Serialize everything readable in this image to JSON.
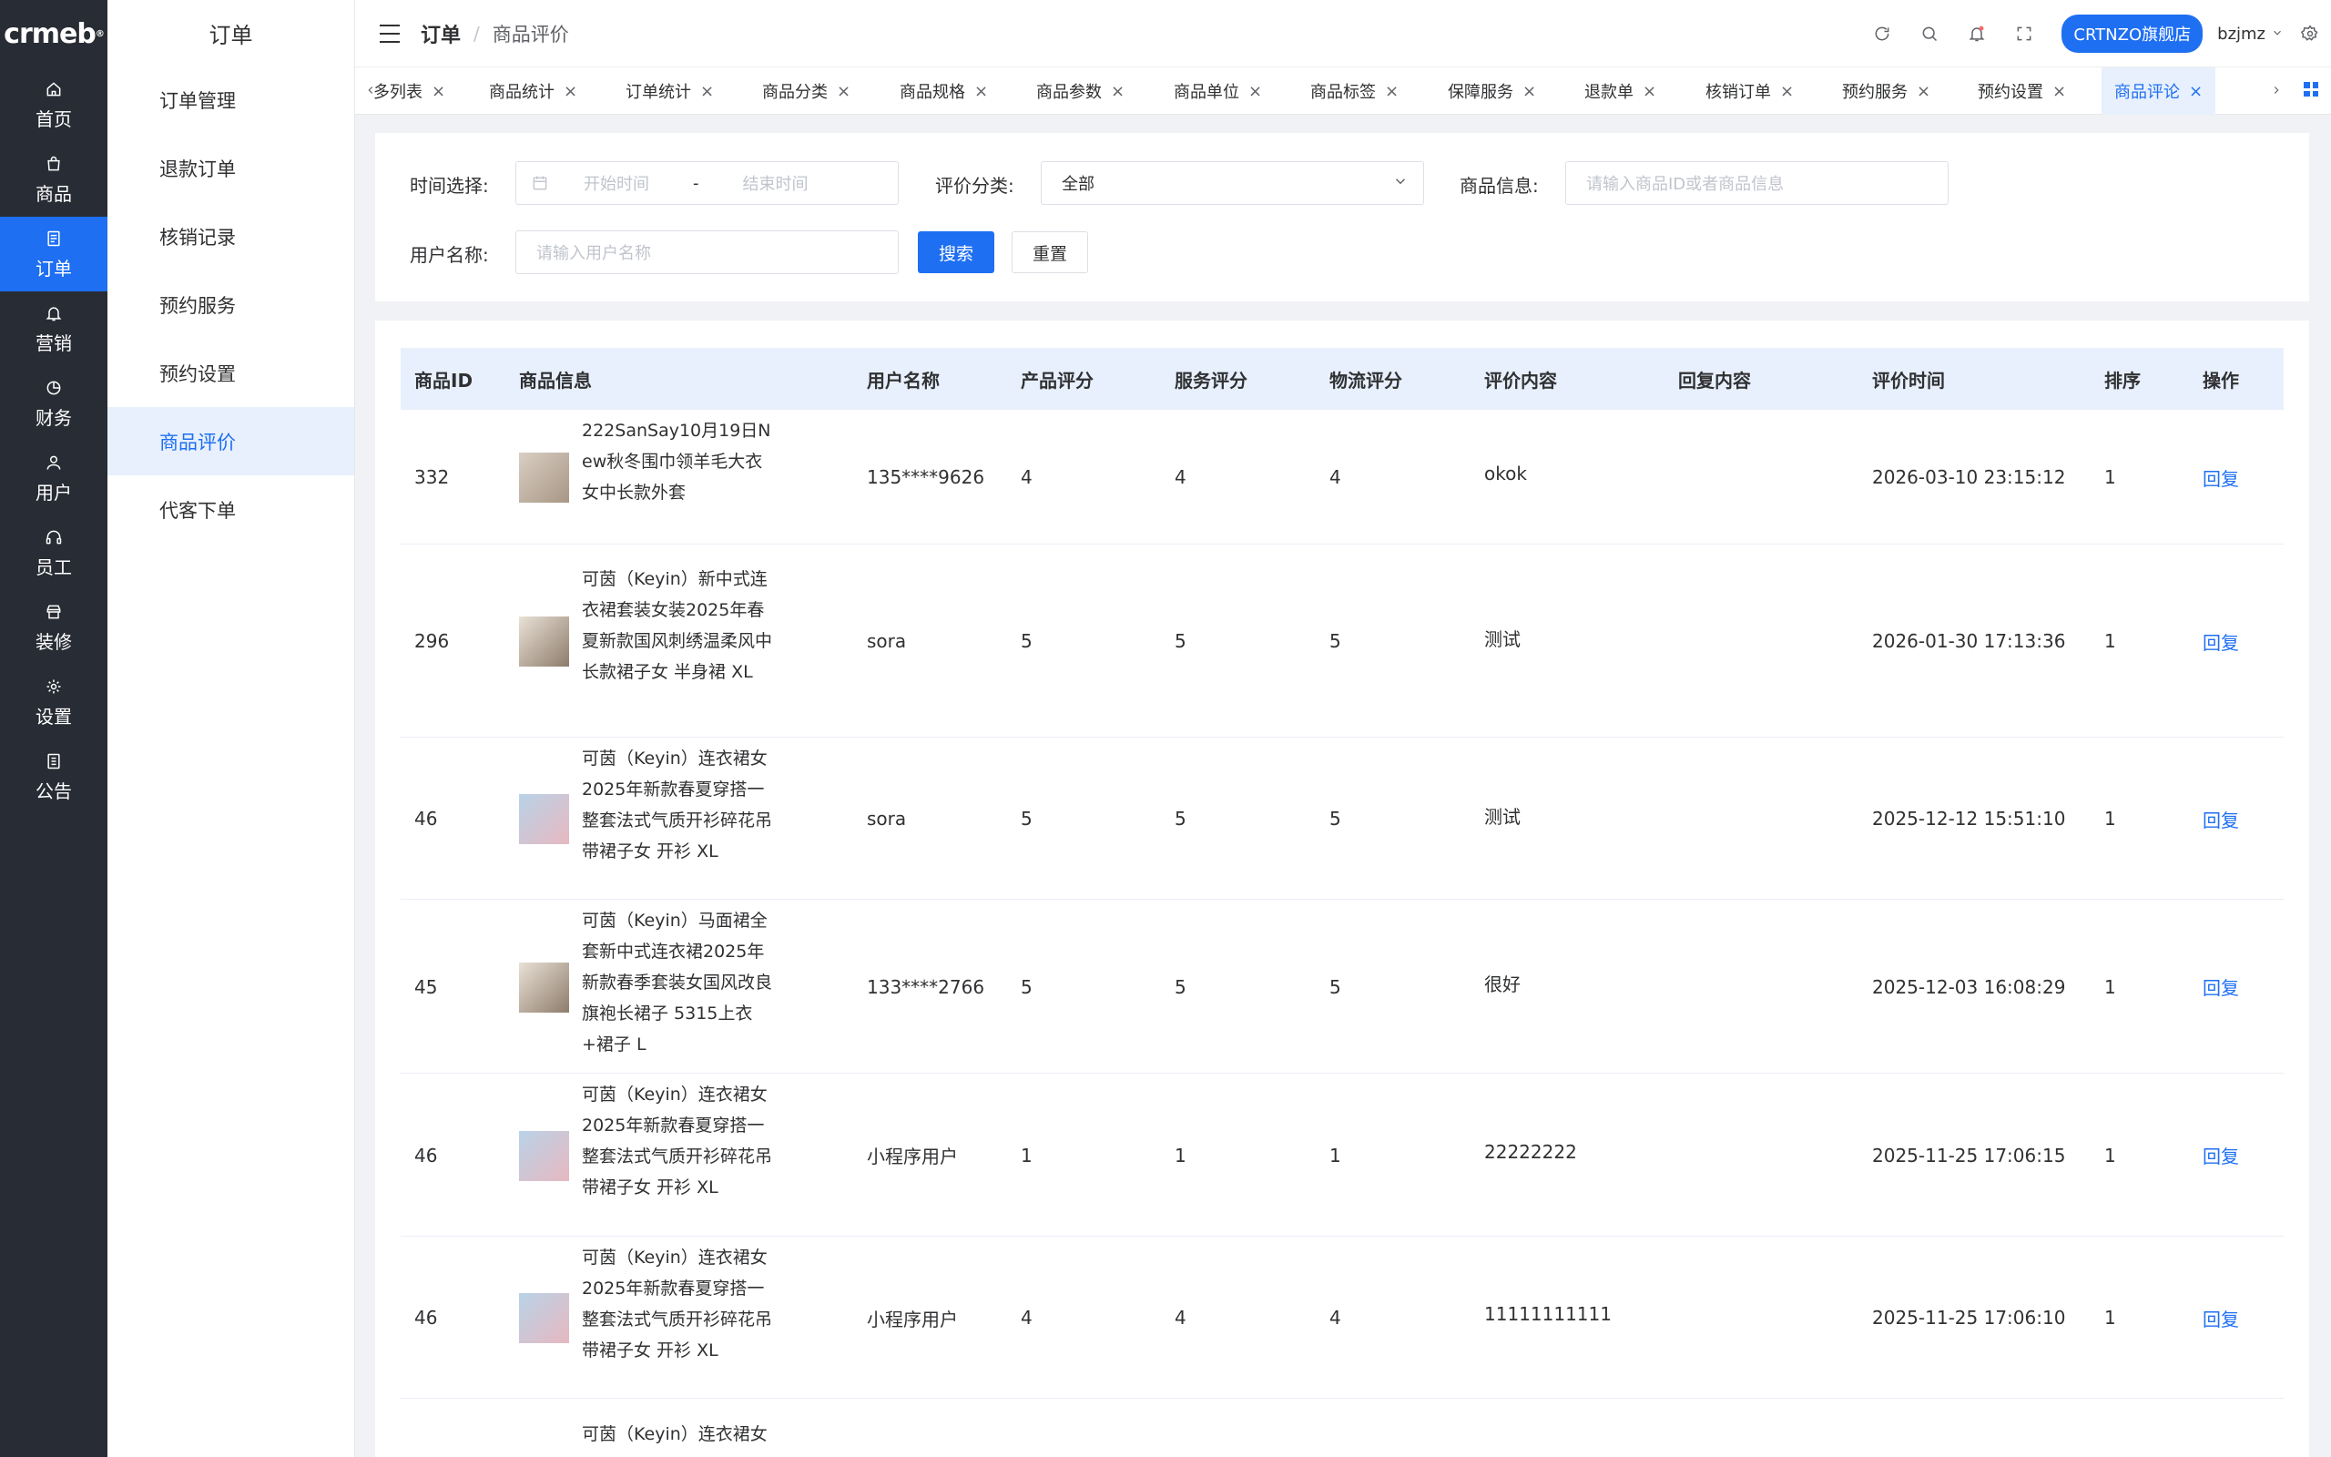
{
  "brand": {
    "logo": "crmeb"
  },
  "rail": [
    {
      "label": "首页",
      "icon": "home-icon"
    },
    {
      "label": "商品",
      "icon": "bag-icon"
    },
    {
      "label": "订单",
      "icon": "order-icon"
    },
    {
      "label": "营销",
      "icon": "bell-icon"
    },
    {
      "label": "财务",
      "icon": "pie-icon"
    },
    {
      "label": "用户",
      "icon": "user-icon"
    },
    {
      "label": "员工",
      "icon": "headset-icon"
    },
    {
      "label": "装修",
      "icon": "shop-icon"
    },
    {
      "label": "设置",
      "icon": "gear-icon"
    },
    {
      "label": "公告",
      "icon": "notice-icon"
    }
  ],
  "submenu": {
    "title": "订单",
    "items": [
      "订单管理",
      "退款订单",
      "核销记录",
      "预约服务",
      "预约设置",
      "商品评价",
      "代客下单"
    ],
    "active": "商品评价"
  },
  "header": {
    "breadcrumb_main": "订单",
    "breadcrumb_sep": "/",
    "breadcrumb_sub": "商品评价",
    "store": "CRTNZO旗舰店",
    "user": "bzjmz"
  },
  "tabs": [
    {
      "label": "多列表"
    },
    {
      "label": "商品统计"
    },
    {
      "label": "订单统计"
    },
    {
      "label": "商品分类"
    },
    {
      "label": "商品规格"
    },
    {
      "label": "商品参数"
    },
    {
      "label": "商品单位"
    },
    {
      "label": "商品标签"
    },
    {
      "label": "保障服务"
    },
    {
      "label": "退款单"
    },
    {
      "label": "核销订单"
    },
    {
      "label": "预约服务"
    },
    {
      "label": "预约设置"
    },
    {
      "label": "商品评论"
    }
  ],
  "filter": {
    "time_label": "时间选择:",
    "start_placeholder": "开始时间",
    "range_sep": "-",
    "end_placeholder": "结束时间",
    "category_label": "评价分类:",
    "category_value": "全部",
    "product_label": "商品信息:",
    "product_placeholder": "请输入商品ID或者商品信息",
    "user_label": "用户名称:",
    "user_placeholder": "请输入用户名称",
    "search_btn": "搜索",
    "reset_btn": "重置"
  },
  "table": {
    "columns": [
      "商品ID",
      "商品信息",
      "用户名称",
      "产品评分",
      "服务评分",
      "物流评分",
      "评价内容",
      "回复内容",
      "评价时间",
      "排序",
      "操作"
    ],
    "rows": [
      {
        "id": "332",
        "product": "222SanSay10月19日New秋冬围巾领羊毛大衣女中长款外套",
        "user": "135****9626",
        "product_score": "4",
        "service_score": "4",
        "logistics_score": "4",
        "content": "okok",
        "reply": "",
        "time": "2026-03-10 23:15:12",
        "sort": "1",
        "action": "回复"
      },
      {
        "id": "296",
        "product": "可茵（Keyin）新中式连衣裙套装女装2025年春夏新款国风刺绣温柔风中长款裙子女 半身裙 XL",
        "user": "sora",
        "product_score": "5",
        "service_score": "5",
        "logistics_score": "5",
        "content": "测试",
        "reply": "",
        "time": "2026-01-30 17:13:36",
        "sort": "1",
        "action": "回复"
      },
      {
        "id": "46",
        "product": "可茵（Keyin）连衣裙女2025年新款春夏穿搭一整套法式气质开衫碎花吊带裙子女 开衫 XL",
        "user": "sora",
        "product_score": "5",
        "service_score": "5",
        "logistics_score": "5",
        "content": "测试",
        "reply": "",
        "time": "2025-12-12 15:51:10",
        "sort": "1",
        "action": "回复"
      },
      {
        "id": "45",
        "product": "可茵（Keyin）马面裙全套新中式连衣裙2025年新款春季套装女国风改良旗袍长裙子 5315上衣+裙子 L",
        "user": "133****2766",
        "product_score": "5",
        "service_score": "5",
        "logistics_score": "5",
        "content": "很好",
        "reply": "",
        "time": "2025-12-03 16:08:29",
        "sort": "1",
        "action": "回复"
      },
      {
        "id": "46",
        "product": "可茵（Keyin）连衣裙女2025年新款春夏穿搭一整套法式气质开衫碎花吊带裙子女 开衫 XL",
        "user": "小程序用户",
        "product_score": "1",
        "service_score": "1",
        "logistics_score": "1",
        "content": "22222222",
        "reply": "",
        "time": "2025-11-25 17:06:15",
        "sort": "1",
        "action": "回复"
      },
      {
        "id": "46",
        "product": "可茵（Keyin）连衣裙女2025年新款春夏穿搭一整套法式气质开衫碎花吊带裙子女 开衫 XL",
        "user": "小程序用户",
        "product_score": "4",
        "service_score": "4",
        "logistics_score": "4",
        "content": "11111111111",
        "reply": "",
        "time": "2025-11-25 17:06:10",
        "sort": "1",
        "action": "回复"
      },
      {
        "id": "",
        "product": "可茵（Keyin）连衣裙女",
        "user": "",
        "product_score": "",
        "service_score": "",
        "logistics_score": "",
        "content": "",
        "reply": "",
        "time": "",
        "sort": "",
        "action": ""
      }
    ]
  }
}
